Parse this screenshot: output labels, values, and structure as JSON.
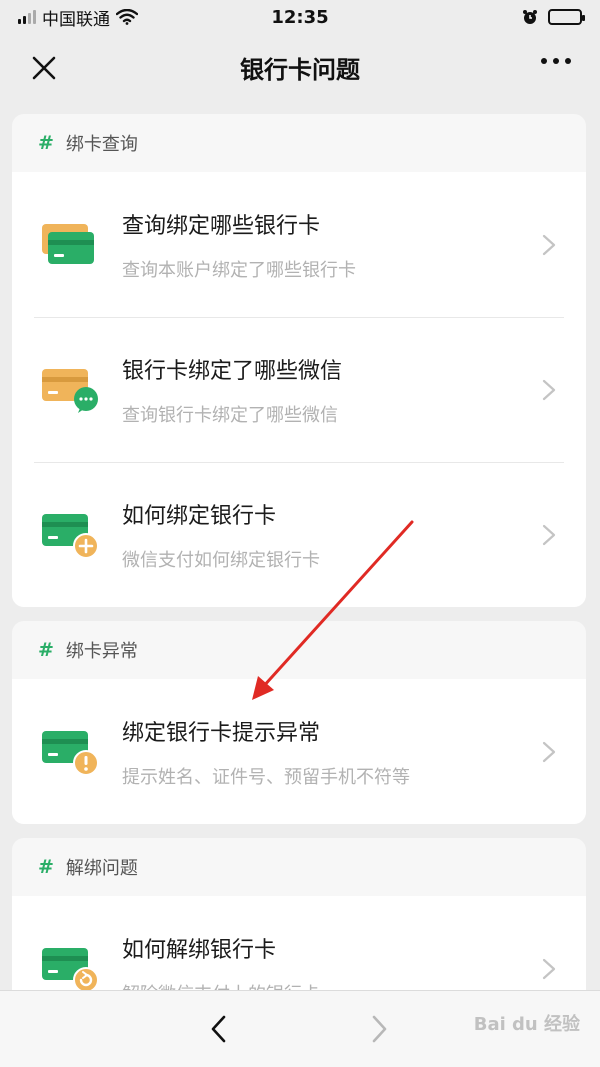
{
  "status_bar": {
    "carrier": "中国联通",
    "time": "12:35"
  },
  "nav": {
    "title": "银行卡问题"
  },
  "sections": [
    {
      "header": "绑卡查询",
      "items": [
        {
          "title": "查询绑定哪些银行卡",
          "subtitle": "查询本账户绑定了哪些银行卡",
          "icon": "stacked-cards-icon"
        },
        {
          "title": "银行卡绑定了哪些微信",
          "subtitle": "查询银行卡绑定了哪些微信",
          "icon": "card-wechat-icon"
        },
        {
          "title": "如何绑定银行卡",
          "subtitle": "微信支付如何绑定银行卡",
          "icon": "card-add-icon"
        }
      ]
    },
    {
      "header": "绑卡异常",
      "items": [
        {
          "title": "绑定银行卡提示异常",
          "subtitle": "提示姓名、证件号、预留手机不符等",
          "icon": "card-warning-icon"
        }
      ]
    },
    {
      "header": "解绑问题",
      "items": [
        {
          "title": "如何解绑银行卡",
          "subtitle": "解除微信支付上的银行卡",
          "icon": "card-unbind-icon"
        }
      ]
    }
  ],
  "watermark": "Bai du 经验",
  "colors": {
    "accent_green": "#2aae67",
    "card_orange": "#f0b45a",
    "annotation_red": "#e02a24"
  }
}
